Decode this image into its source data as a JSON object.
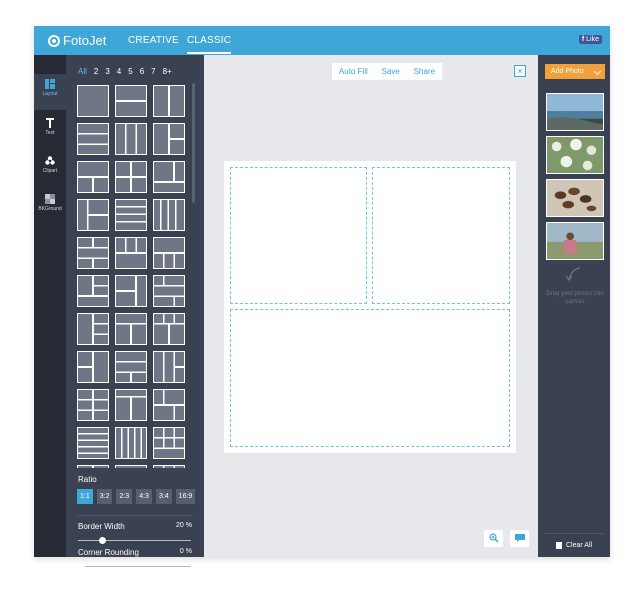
{
  "app": {
    "brand": "FotoJet"
  },
  "nav": {
    "tabs": [
      {
        "label": "CREATIVE"
      },
      {
        "label": "CLASSIC"
      }
    ],
    "active_tab": "CLASSIC",
    "fb_like": "Like"
  },
  "sidebar": {
    "items": [
      {
        "label": "Layout",
        "icon": "layout-icon"
      },
      {
        "label": "Text",
        "icon": "text-icon"
      },
      {
        "label": "Clipart",
        "icon": "clipart-icon"
      },
      {
        "label": "BKGround",
        "icon": "background-icon"
      }
    ],
    "active": "Layout"
  },
  "layouts": {
    "filters": [
      "All",
      "2",
      "3",
      "4",
      "5",
      "6",
      "7",
      "8+"
    ],
    "active_filter": "All",
    "ratio_label": "Ratio",
    "ratios": [
      "1:1",
      "3:2",
      "2:3",
      "4:3",
      "3:4",
      "16:9"
    ],
    "active_ratio": "1:1",
    "border_width": {
      "label": "Border Width",
      "value": "20",
      "unit": "%",
      "fraction": 0.2
    },
    "corner_rounding": {
      "label": "Corner Rounding",
      "value": "0",
      "unit": "%",
      "fraction": 0.0
    }
  },
  "toolbar": {
    "auto_fill": "Auto Fill",
    "save": "Save",
    "share": "Share",
    "close_label": "×"
  },
  "canvas": {
    "layout": "two-top-one-bottom"
  },
  "photos": {
    "add_label": "Add Photo",
    "items": [
      "photo-1",
      "photo-2",
      "photo-3",
      "photo-4"
    ],
    "drag_hint": "Drag your photos into canvas",
    "clear_all": "Clear All"
  },
  "colors": {
    "accent": "#3fa6d8",
    "topbar": "#3fa6d8",
    "panel": "#3a4150",
    "iconbar": "#252a34",
    "add_photo": "#f2a03a"
  }
}
